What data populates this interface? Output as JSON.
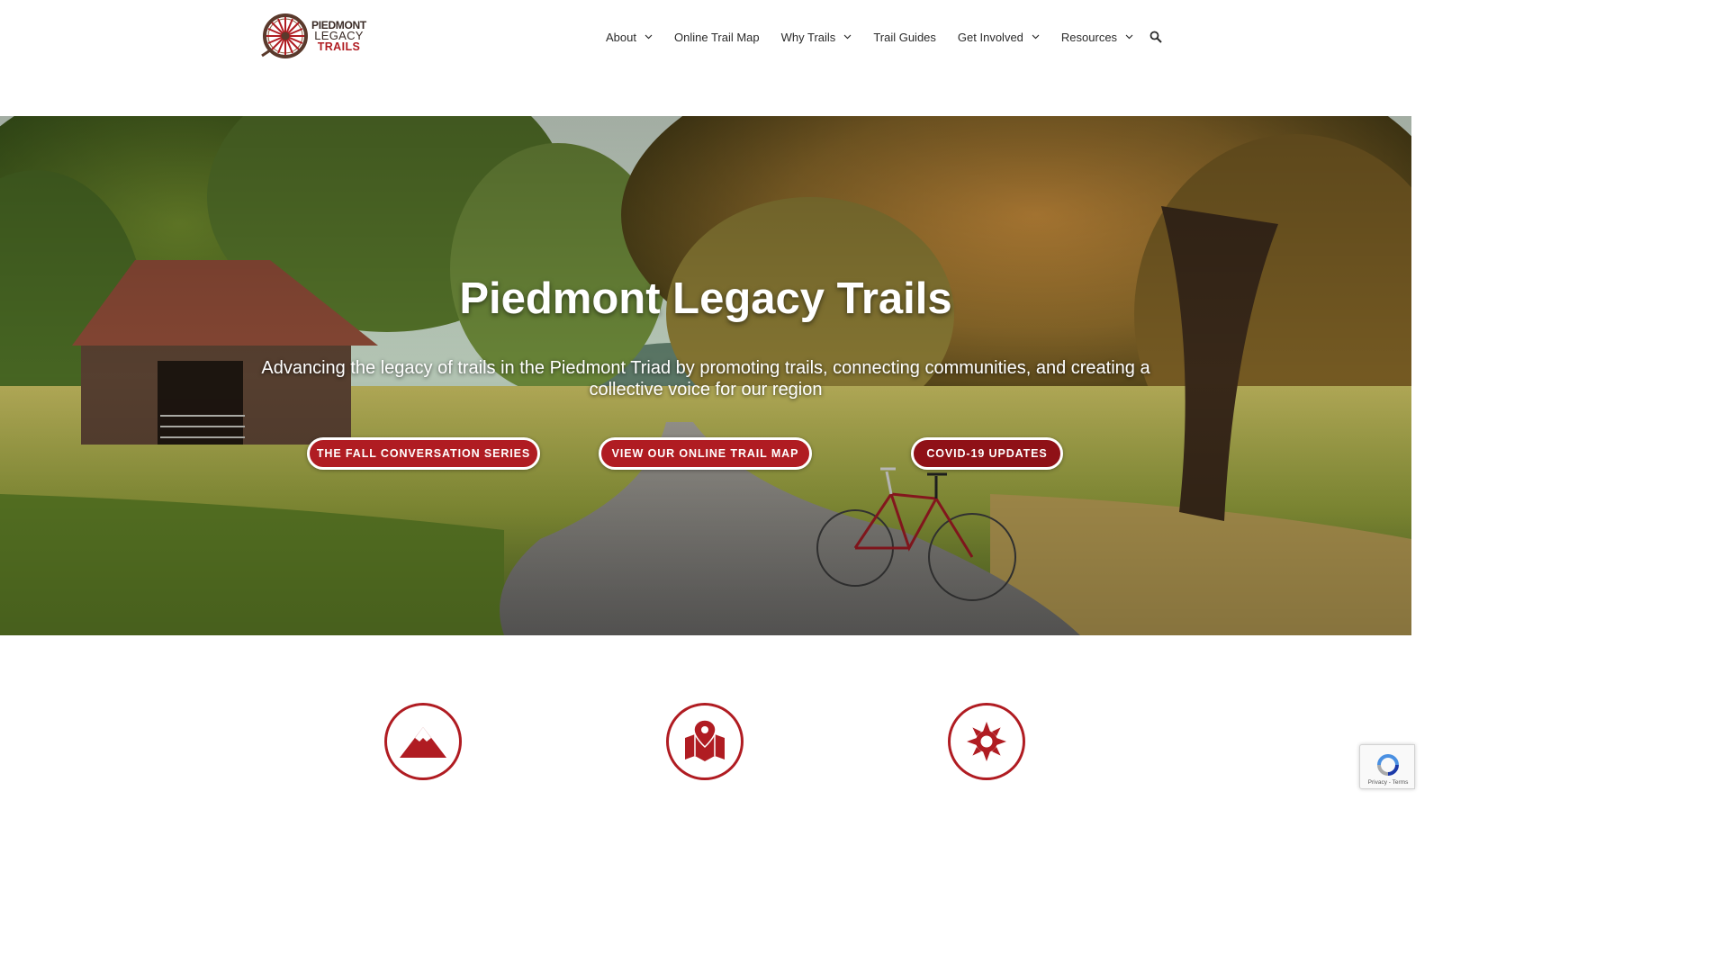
{
  "brand": {
    "line1": "PIEDMONT",
    "line2": "LEGACY",
    "line3": "TRAILS",
    "icon": "wagon-wheel-logo"
  },
  "nav": {
    "items": [
      {
        "label": "About",
        "dropdown": true
      },
      {
        "label": "Online Trail Map",
        "dropdown": false
      },
      {
        "label": "Why Trails",
        "dropdown": true
      },
      {
        "label": "Trail Guides",
        "dropdown": false
      },
      {
        "label": "Get Involved",
        "dropdown": true
      },
      {
        "label": "Resources",
        "dropdown": true
      }
    ],
    "search_icon": "search-icon"
  },
  "hero": {
    "title": "Piedmont Legacy Trails",
    "subtitle": "Advancing the legacy of trails in the Piedmont Triad by promoting trails, connecting communities, and creating a collective voice for our region",
    "buttons": [
      {
        "label": "THE FALL CONVERSATION SERIES"
      },
      {
        "label": "VIEW OUR ONLINE TRAIL MAP"
      },
      {
        "label": "COVID-19 UPDATES"
      }
    ],
    "image": "rural-trail-with-barn-and-red-bicycle"
  },
  "features": {
    "icons": [
      "mountain-icon",
      "map-pin-icon",
      "sun-icon"
    ]
  },
  "recaptcha": {
    "links": "Privacy - Terms"
  },
  "colors": {
    "brand_red": "#b01c22",
    "brand_dark_red": "#8f1117",
    "text_dark": "#2b2b2b"
  }
}
